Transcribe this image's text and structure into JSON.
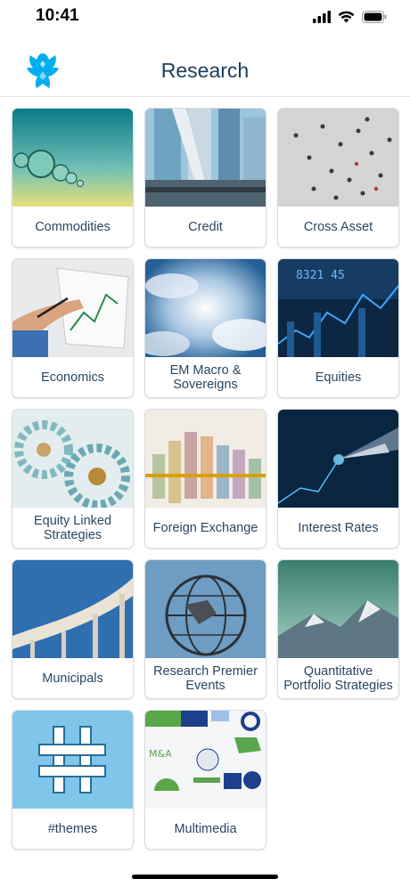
{
  "status_bar": {
    "time": "10:41"
  },
  "header": {
    "title": "Research"
  },
  "tiles": [
    {
      "label": "Commodities",
      "image": "water-droplets-image"
    },
    {
      "label": "Credit",
      "image": "city-buildings-image"
    },
    {
      "label": "Cross Asset",
      "image": "crowd-aerial-image"
    },
    {
      "label": "Economics",
      "image": "hand-chart-image"
    },
    {
      "label": "EM Macro & Sovereigns",
      "image": "sky-clouds-image"
    },
    {
      "label": "Equities",
      "image": "stock-ticker-image"
    },
    {
      "label": "Equity Linked Strategies",
      "image": "gears-image"
    },
    {
      "label": "Foreign Exchange",
      "image": "currency-rolls-image"
    },
    {
      "label": "Interest Rates",
      "image": "pen-tip-image"
    },
    {
      "label": "Municipals",
      "image": "highway-overpass-image"
    },
    {
      "label": "Research Premier Events",
      "image": "unisphere-image"
    },
    {
      "label": "Quantitative Portfolio Strategies",
      "image": "mountains-image"
    },
    {
      "label": "#themes",
      "image": "hashtag-image"
    },
    {
      "label": "Multimedia",
      "image": "infographic-image"
    }
  ]
}
